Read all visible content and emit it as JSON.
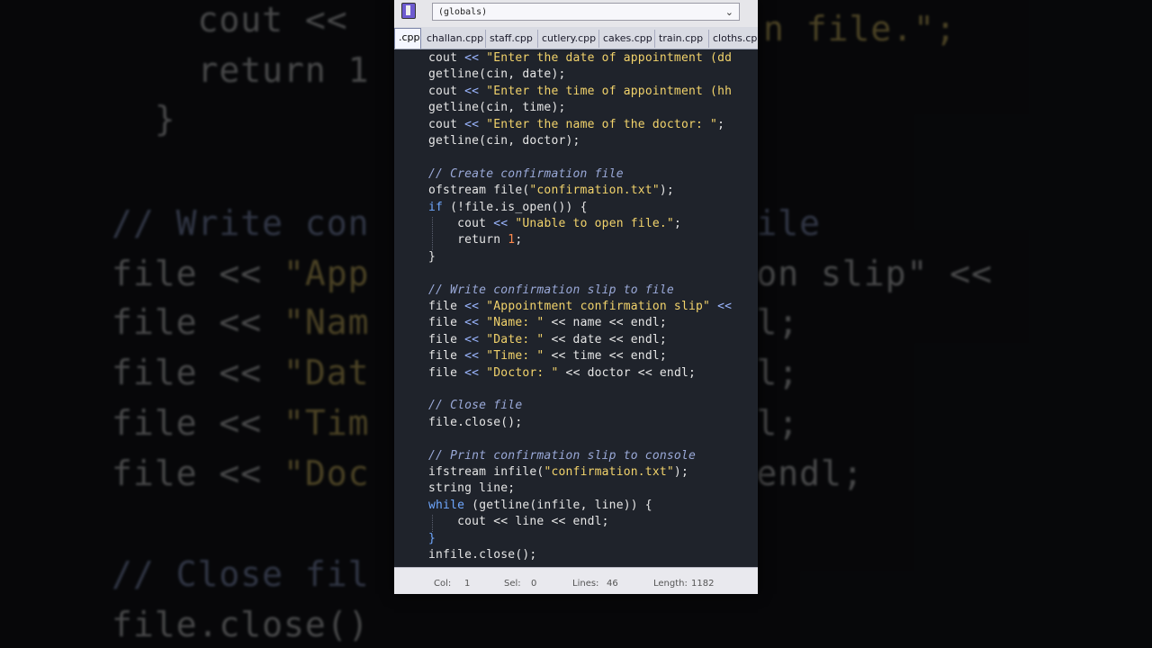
{
  "colors": {
    "plain": "#e6e6e6",
    "string": "#f2d36b",
    "keyword": "#6fa8ff",
    "comment": "#9aa9d8",
    "number": "#ff8a4c",
    "operator": "#9bb6ff"
  },
  "background": {
    "lines": [
      [
        {
          "t": "    cout << ",
          "c": "plain"
        }
      ],
      [
        {
          "t": "    return 1",
          "c": "plain"
        }
      ],
      [
        {
          "t": "  }",
          "c": "plain"
        }
      ],
      [
        {
          "t": "// Write con",
          "c": "comment"
        },
        {
          "t": "              to file",
          "c": "comment"
        }
      ],
      [
        {
          "t": "file << ",
          "c": "plain"
        },
        {
          "t": "\"App",
          "c": "string"
        },
        {
          "t": "              mation slip\" << ",
          "c": "plain"
        }
      ],
      [
        {
          "t": "file << ",
          "c": "plain"
        },
        {
          "t": "\"Nam",
          "c": "string"
        },
        {
          "t": "               endl;",
          "c": "plain"
        }
      ],
      [
        {
          "t": "file << ",
          "c": "plain"
        },
        {
          "t": "\"Dat",
          "c": "string"
        },
        {
          "t": "               endl;",
          "c": "plain"
        }
      ],
      [
        {
          "t": "file << ",
          "c": "plain"
        },
        {
          "t": "\"Tim",
          "c": "string"
        },
        {
          "t": "               endl;",
          "c": "plain"
        }
      ],
      [
        {
          "t": "file << ",
          "c": "plain"
        },
        {
          "t": "\"Doc",
          "c": "string"
        },
        {
          "t": "             r << endl;",
          "c": "plain"
        }
      ],
      [
        {
          "t": "// Close fil",
          "c": "comment"
        }
      ],
      [
        {
          "t": "file.close()",
          "c": "plain"
        }
      ]
    ],
    "right_top": "n file.\";"
  },
  "toolbar": {
    "scope_select": "(globals)"
  },
  "tabs": [
    {
      "label": ".cpp"
    },
    {
      "label": "challan.cpp"
    },
    {
      "label": "staff.cpp"
    },
    {
      "label": "cutlery.cpp"
    },
    {
      "label": "cakes.cpp"
    },
    {
      "label": "train.cpp"
    },
    {
      "label": "cloths.cpp"
    }
  ],
  "code": [
    [
      {
        "t": "cout ",
        "c": "plain"
      },
      {
        "t": "<< ",
        "c": "operator"
      },
      {
        "t": "\"Enter the date of appointment (dd",
        "c": "string"
      }
    ],
    [
      {
        "t": "getline(cin, date);",
        "c": "plain"
      }
    ],
    [
      {
        "t": "cout ",
        "c": "plain"
      },
      {
        "t": "<< ",
        "c": "operator"
      },
      {
        "t": "\"Enter the time of appointment (hh",
        "c": "string"
      }
    ],
    [
      {
        "t": "getline(cin, time);",
        "c": "plain"
      }
    ],
    [
      {
        "t": "cout ",
        "c": "plain"
      },
      {
        "t": "<< ",
        "c": "operator"
      },
      {
        "t": "\"Enter the name of the doctor: \"",
        "c": "string"
      },
      {
        "t": ";",
        "c": "plain"
      }
    ],
    [
      {
        "t": "getline(cin, doctor);",
        "c": "plain"
      }
    ],
    [],
    [
      {
        "t": "// Create confirmation file",
        "c": "comment"
      }
    ],
    [
      {
        "t": "ofstream file(",
        "c": "plain"
      },
      {
        "t": "\"confirmation.txt\"",
        "c": "string"
      },
      {
        "t": ");",
        "c": "plain"
      }
    ],
    [
      {
        "t": "if",
        "c": "keyword"
      },
      {
        "t": " (!file.is_open()) {",
        "c": "plain"
      }
    ],
    [
      {
        "t": "    cout ",
        "c": "plain"
      },
      {
        "t": "<< ",
        "c": "operator"
      },
      {
        "t": "\"Unable to open file.\"",
        "c": "string"
      },
      {
        "t": ";",
        "c": "plain"
      }
    ],
    [
      {
        "t": "    return ",
        "c": "plain"
      },
      {
        "t": "1",
        "c": "number"
      },
      {
        "t": ";",
        "c": "plain"
      }
    ],
    [
      {
        "t": "}",
        "c": "plain"
      }
    ],
    [],
    [
      {
        "t": "// Write confirmation slip to file",
        "c": "comment"
      }
    ],
    [
      {
        "t": "file ",
        "c": "plain"
      },
      {
        "t": "<< ",
        "c": "operator"
      },
      {
        "t": "\"Appointment confirmation slip\"",
        "c": "string"
      },
      {
        "t": " << ",
        "c": "operator"
      }
    ],
    [
      {
        "t": "file ",
        "c": "plain"
      },
      {
        "t": "<< ",
        "c": "operator"
      },
      {
        "t": "\"Name: \"",
        "c": "string"
      },
      {
        "t": " << name << endl;",
        "c": "plain"
      }
    ],
    [
      {
        "t": "file ",
        "c": "plain"
      },
      {
        "t": "<< ",
        "c": "operator"
      },
      {
        "t": "\"Date: \"",
        "c": "string"
      },
      {
        "t": " << date << endl;",
        "c": "plain"
      }
    ],
    [
      {
        "t": "file ",
        "c": "plain"
      },
      {
        "t": "<< ",
        "c": "operator"
      },
      {
        "t": "\"Time: \"",
        "c": "string"
      },
      {
        "t": " << time << endl;",
        "c": "plain"
      }
    ],
    [
      {
        "t": "file ",
        "c": "plain"
      },
      {
        "t": "<< ",
        "c": "operator"
      },
      {
        "t": "\"Doctor: \"",
        "c": "string"
      },
      {
        "t": " << doctor << endl;",
        "c": "plain"
      }
    ],
    [],
    [
      {
        "t": "// Close file",
        "c": "comment"
      }
    ],
    [
      {
        "t": "file.close();",
        "c": "plain"
      }
    ],
    [],
    [
      {
        "t": "// Print confirmation slip to console",
        "c": "comment"
      }
    ],
    [
      {
        "t": "ifstream infile(",
        "c": "plain"
      },
      {
        "t": "\"confirmation.txt\"",
        "c": "string"
      },
      {
        "t": ");",
        "c": "plain"
      }
    ],
    [
      {
        "t": "string line;",
        "c": "plain"
      }
    ],
    [
      {
        "t": "while",
        "c": "keyword"
      },
      {
        "t": " (getline(infile, line)) {",
        "c": "plain"
      }
    ],
    [
      {
        "t": "    cout << line << endl;",
        "c": "plain"
      }
    ],
    [
      {
        "t": "}",
        "c": "keyword"
      }
    ],
    [
      {
        "t": "infile.close();",
        "c": "plain"
      }
    ]
  ],
  "status": {
    "col_label": "Col:",
    "col_value": "1",
    "sel_label": "Sel:",
    "sel_value": "0",
    "lines_label": "Lines:",
    "lines_value": "46",
    "length_label": "Length:",
    "length_value": "1182"
  }
}
